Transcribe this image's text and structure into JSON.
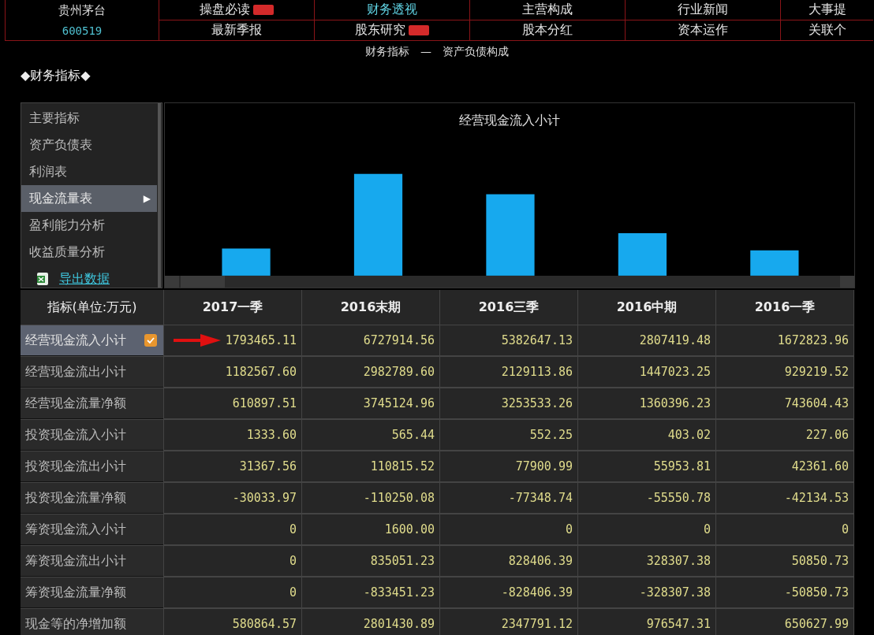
{
  "stock": {
    "name": "贵州茅台",
    "code": "600519"
  },
  "nav": [
    [
      {
        "label": "操盘必读",
        "badge": true,
        "selected": false
      },
      {
        "label": "财务透视",
        "badge": false,
        "selected": true
      },
      {
        "label": "主营构成",
        "badge": false,
        "selected": false
      },
      {
        "label": "行业新闻",
        "badge": false,
        "selected": false
      },
      {
        "label": "大事提",
        "badge": false,
        "selected": false
      }
    ],
    [
      {
        "label": "最新季报",
        "badge": false,
        "selected": false
      },
      {
        "label": "股东研究",
        "badge": true,
        "selected": false
      },
      {
        "label": "股本分红",
        "badge": false,
        "selected": false
      },
      {
        "label": "资本运作",
        "badge": false,
        "selected": false
      },
      {
        "label": "关联个",
        "badge": false,
        "selected": false
      }
    ]
  ],
  "breadcrumb": "财务指标　—　资产负债构成",
  "section_title": "◆财务指标◆",
  "sidebar": {
    "items": [
      {
        "label": "主要指标",
        "selected": false
      },
      {
        "label": "资产负债表",
        "selected": false
      },
      {
        "label": "利润表",
        "selected": false
      },
      {
        "label": "现金流量表",
        "selected": true,
        "arrow": "▶"
      },
      {
        "label": "盈利能力分析",
        "selected": false
      },
      {
        "label": "收益质量分析",
        "selected": false
      }
    ],
    "export_link": "导出数据"
  },
  "chart": {
    "title": "经营现金流入小计"
  },
  "table": {
    "columns": [
      "指标(单位:万元)",
      "2017一季",
      "2016末期",
      "2016三季",
      "2016中期",
      "2016一季"
    ],
    "rows": [
      {
        "label": "经营现金流入小计",
        "selected": true,
        "arrow": true,
        "values": [
          "1793465.11",
          "6727914.56",
          "5382647.13",
          "2807419.48",
          "1672823.96"
        ]
      },
      {
        "label": "经营现金流出小计",
        "selected": false,
        "arrow": false,
        "values": [
          "1182567.60",
          "2982789.60",
          "2129113.86",
          "1447023.25",
          "929219.52"
        ]
      },
      {
        "label": "经营现金流量净额",
        "selected": false,
        "arrow": false,
        "values": [
          "610897.51",
          "3745124.96",
          "3253533.26",
          "1360396.23",
          "743604.43"
        ]
      },
      {
        "label": "投资现金流入小计",
        "selected": false,
        "arrow": false,
        "values": [
          "1333.60",
          "565.44",
          "552.25",
          "403.02",
          "227.06"
        ]
      },
      {
        "label": "投资现金流出小计",
        "selected": false,
        "arrow": false,
        "values": [
          "31367.56",
          "110815.52",
          "77900.99",
          "55953.81",
          "42361.60"
        ]
      },
      {
        "label": "投资现金流量净额",
        "selected": false,
        "arrow": false,
        "values": [
          "-30033.97",
          "-110250.08",
          "-77348.74",
          "-55550.78",
          "-42134.53"
        ]
      },
      {
        "label": "筹资现金流入小计",
        "selected": false,
        "arrow": false,
        "values": [
          "0",
          "1600.00",
          "0",
          "0",
          "0"
        ]
      },
      {
        "label": "筹资现金流出小计",
        "selected": false,
        "arrow": false,
        "values": [
          "0",
          "835051.23",
          "828406.39",
          "328307.38",
          "50850.73"
        ]
      },
      {
        "label": "筹资现金流量净额",
        "selected": false,
        "arrow": false,
        "values": [
          "0",
          "-833451.23",
          "-828406.39",
          "-328307.38",
          "-50850.73"
        ]
      },
      {
        "label": "现金等的净增加额",
        "selected": false,
        "arrow": false,
        "values": [
          "580864.57",
          "2801430.89",
          "2347791.12",
          "976547.31",
          "650627.99"
        ]
      }
    ]
  }
}
